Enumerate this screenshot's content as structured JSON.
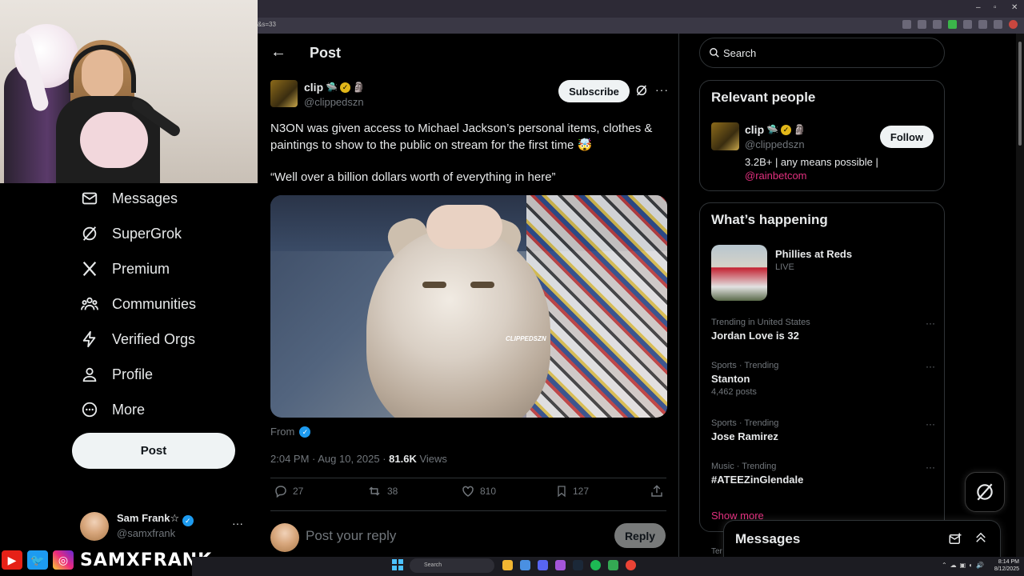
{
  "browser": {
    "address_fragment": "&s=33",
    "window_controls": [
      "–",
      "▫",
      "✕"
    ]
  },
  "nav": {
    "items": [
      {
        "label": "Messages",
        "icon": "envelope-icon"
      },
      {
        "label": "SuperGrok",
        "icon": "grok-icon"
      },
      {
        "label": "Premium",
        "icon": "x-logo-icon"
      },
      {
        "label": "Communities",
        "icon": "people-icon"
      },
      {
        "label": "Verified Orgs",
        "icon": "lightning-icon"
      },
      {
        "label": "Profile",
        "icon": "person-icon"
      },
      {
        "label": "More",
        "icon": "more-circle-icon"
      }
    ],
    "post_label": "Post",
    "account": {
      "name": "Sam Frank☆",
      "handle": "@samxfrank",
      "more": "···"
    }
  },
  "overlay": {
    "social_name": "SAMXFRANK",
    "socials": [
      "youtube-icon",
      "twitter-icon",
      "instagram-icon"
    ]
  },
  "main": {
    "title": "Post",
    "author": {
      "name": "clip",
      "emojis": "🛸",
      "handle": "@clippedszn"
    },
    "subscribe_label": "Subscribe",
    "text": "N3ON was given access to Michael Jackson’s personal items, clothes & paintings to show to the public on stream for the first time 🤯",
    "quote": "“Well over a billion dollars worth of everything in here”",
    "media_watermark": "CLIPPEDSZN",
    "from_label": "From",
    "meta": {
      "time": "2:04 PM · Aug 10, 2025 · ",
      "views_count": "81.6K",
      "views_label": " Views"
    },
    "actions": {
      "replies": "27",
      "reposts": "38",
      "likes": "810",
      "bookmarks": "127"
    },
    "reply_placeholder": "Post your reply",
    "reply_label": "Reply"
  },
  "sidebar": {
    "search_placeholder": "Search",
    "relevant": {
      "title": "Relevant people",
      "name": "clip",
      "handle": "@clippedszn",
      "bio": "3.2B+ | any means possible |",
      "bio_link": "@rainbetcom",
      "follow_label": "Follow"
    },
    "happening": {
      "title": "What’s happening",
      "featured": {
        "title": "Phillies at Reds",
        "status": "LIVE"
      },
      "trends": [
        {
          "meta": "Trending in United States",
          "name": "Jordan Love is 32",
          "count": ""
        },
        {
          "meta": "Sports · Trending",
          "name": "Stanton",
          "count": "4,462 posts"
        },
        {
          "meta": "Sports · Trending",
          "name": "Jose Ramirez",
          "count": ""
        },
        {
          "meta": "Music · Trending",
          "name": "#ATEEZinGlendale",
          "count": ""
        }
      ],
      "show_more": "Show more"
    },
    "messages_title": "Messages",
    "footer_fragment": "Ter"
  },
  "taskbar": {
    "search_label": "Search",
    "clock_time": "8:14 PM",
    "clock_date": "8/12/2025"
  },
  "colors": {
    "accent_blue": "#1d9bf0",
    "pink_link": "#e3307f",
    "background": "#000000"
  }
}
